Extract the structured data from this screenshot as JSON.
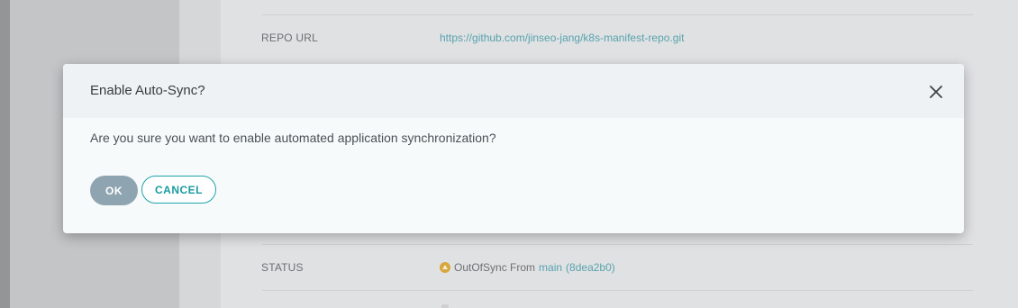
{
  "background": {
    "rows": [
      {
        "label": "REPO URL",
        "value": "https://github.com/jinseo-jang/k8s-manifest-repo.git"
      },
      {
        "label": "STATUS",
        "status_text": "OutOfSync From",
        "branch": "main",
        "revision": "(8dea2b0)"
      }
    ]
  },
  "modal": {
    "title": "Enable Auto-Sync?",
    "message": "Are you sure you want to enable automated application synchronization?",
    "ok_label": "OK",
    "cancel_label": "CANCEL",
    "close_icon": "close-icon"
  },
  "colors": {
    "accent": "#1fa4a9",
    "ok_button": "#8fa4b1",
    "status_outofsync": "#d7a73b"
  }
}
